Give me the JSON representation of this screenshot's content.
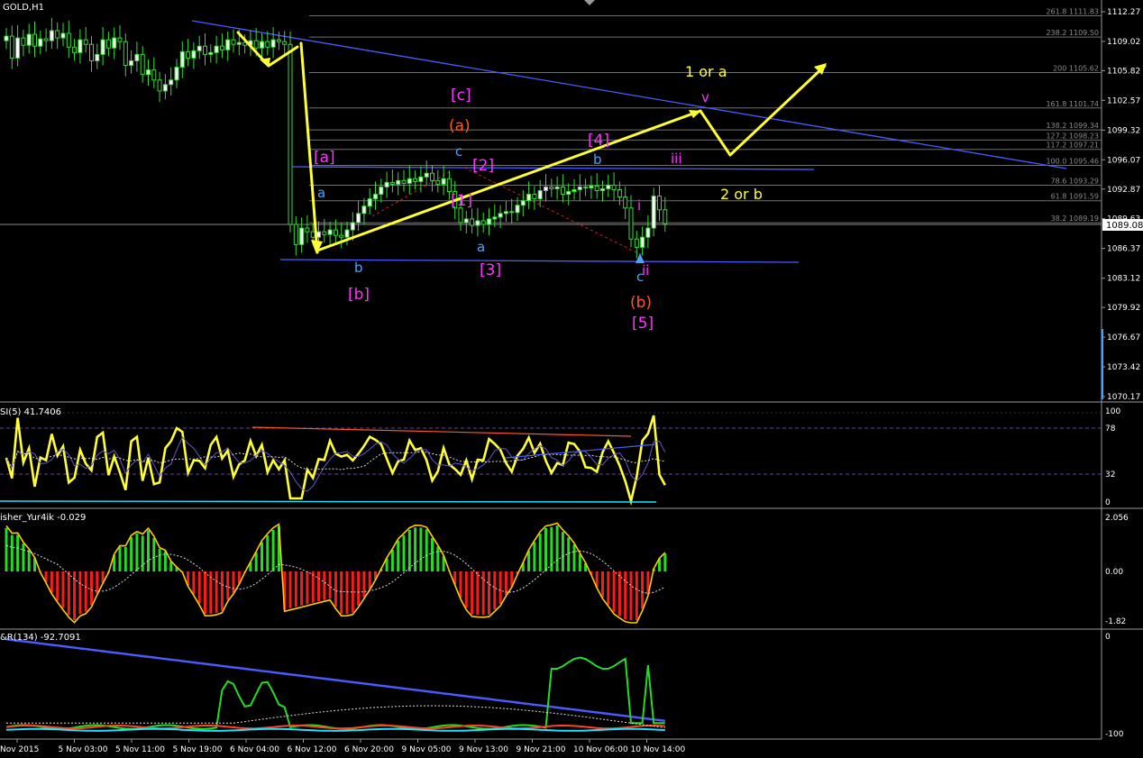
{
  "window": {
    "title": "GOLD,H1"
  },
  "colors": {
    "background": "#000000",
    "price_line": "#ffffff",
    "fib_line": "#6f6f6f",
    "wave_path": "#ffff33",
    "trend_line": "#4a5cff",
    "label_blue": "#4aa3ff",
    "label_magenta": "#ff33ff",
    "label_orange": "#ff5a1f",
    "label_yellow": "#ffff33",
    "rsi": "#ffff33",
    "fisher_up": "#22dd22",
    "fisher_down": "#ff1a1a",
    "wpr_fast": "#22dd22",
    "wpr_mid": "#ff4422",
    "wpr_slow": "#22e0ff",
    "wpr_trend": "#4a5cff"
  },
  "price_axis": {
    "ticks": [
      "1112.27",
      "1109.02",
      "1105.82",
      "1102.57",
      "1099.32",
      "1096.07",
      "1092.87",
      "1089.63",
      "1086.37",
      "1083.12",
      "1079.92",
      "1076.67",
      "1073.42",
      "1070.17"
    ],
    "current_price": "1089.08"
  },
  "fib_levels": [
    {
      "label": "261.8",
      "price": 1111.83,
      "text": "261.8 1111.83"
    },
    {
      "label": "238.2",
      "price": 1109.5,
      "text": "238.2 1109.50"
    },
    {
      "label": "200",
      "price": 1105.62,
      "text": "200 1105.62"
    },
    {
      "label": "161.8",
      "price": 1101.74,
      "text": "161.8 1101.74"
    },
    {
      "label": "138.2",
      "price": 1099.34,
      "text": "138.2 1099.34"
    },
    {
      "label": "127.2",
      "price": 1098.23,
      "text": "127.2 1098.23"
    },
    {
      "label": "117.2",
      "price": 1097.21,
      "text": "117.2 1097.21"
    },
    {
      "label": "100.0",
      "price": 1095.46,
      "text": "100.0 1095.46"
    },
    {
      "label": "78.6",
      "price": 1093.29,
      "text": "78.6 1093.29"
    },
    {
      "label": "61.8",
      "price": 1091.59,
      "text": "61.8 1091.59"
    },
    {
      "label": "38.2",
      "price": 1089.19,
      "text": "38.2 1089.19"
    }
  ],
  "wave_labels": {
    "bracket_a": "[a]",
    "a_blue_1": "a",
    "b_blue_1": "b",
    "bracket_b": "[b]",
    "bracket_c": "[c]",
    "paren_a": "(a)",
    "c_blue": "c",
    "bracket_2": "[2]",
    "bracket_1": "[1]",
    "a_blue_2": "a",
    "bracket_3": "[3]",
    "bracket_4": "[4]",
    "b_blue_2": "b",
    "wave_iii": "iii",
    "wave_i": "i",
    "c_blue_2": "c",
    "wave_ii": "ii",
    "paren_b": "(b)",
    "bracket_5": "[5]",
    "wave_v": "v",
    "one_or_a": "1 or a",
    "two_or_b": "2 or b"
  },
  "indicators": {
    "rsi": {
      "title": "SI(5) 41.7406",
      "ticks": [
        "100",
        "78",
        "32",
        "0"
      ]
    },
    "fisher": {
      "title": "isher_Yur4ik -0.029",
      "ticks": [
        "2.056",
        "0.00",
        "-1.82"
      ]
    },
    "wpr": {
      "title": "&R(134) -92.7091",
      "ticks": [
        "0",
        "-100"
      ]
    }
  },
  "time_axis": {
    "labels": [
      "Nov 2015",
      "5 Nov 03:00",
      "5 Nov 11:00",
      "5 Nov 19:00",
      "6 Nov 04:00",
      "6 Nov 12:00",
      "6 Nov 20:00",
      "9 Nov 05:00",
      "9 Nov 13:00",
      "9 Nov 21:00",
      "10 Nov 06:00",
      "10 Nov 14:00"
    ]
  },
  "chart_data": {
    "type": "line",
    "title": "GOLD,H1",
    "ylim": [
      1070.17,
      1112.27
    ],
    "series": [
      {
        "name": "GOLD,H1",
        "values": [
          1109.6,
          1107.2,
          1109.4,
          1108.6,
          1109.8,
          1108.5,
          1109.3,
          1109.1,
          1110.2,
          1109.4,
          1109.9,
          1108.4,
          1107.8,
          1109.2,
          1108.7,
          1106.9,
          1107.6,
          1109.2,
          1108.3,
          1109.4,
          1109.0,
          1106.4,
          1106.9,
          1107.6,
          1105.4,
          1105.9,
          1104.8,
          1103.6,
          1104.3,
          1104.8,
          1106.2,
          1107.9,
          1107.2,
          1108.0,
          1108.5,
          1107.6,
          1107.8,
          1108.5,
          1108.1,
          1109.2,
          1108.7,
          1108.9,
          1108.6,
          1109.1,
          1108.3,
          1109.0,
          1108.4,
          1109.2,
          1109.0,
          1108.7,
          1089.0,
          1086.8,
          1088.6,
          1088.2,
          1087.6,
          1088.2,
          1087.9,
          1088.4,
          1087.8,
          1087.6,
          1088.4,
          1089.2,
          1090.2,
          1091.0,
          1091.8,
          1092.3,
          1093.1,
          1093.6,
          1093.4,
          1093.8,
          1093.5,
          1094.0,
          1093.7,
          1094.2,
          1094.6,
          1093.8,
          1093.4,
          1094.0,
          1092.6,
          1090.8,
          1089.2,
          1089.6,
          1088.9,
          1089.4,
          1089.0,
          1089.6,
          1089.8,
          1090.2,
          1090.4,
          1090.3,
          1091.1,
          1091.6,
          1092.3,
          1091.8,
          1092.7,
          1093.1,
          1092.9,
          1093.1,
          1092.3,
          1092.6,
          1092.8,
          1093.1,
          1093.0,
          1093.2,
          1092.7,
          1092.9,
          1093.3,
          1092.8,
          1092.0,
          1090.8,
          1087.4,
          1086.5,
          1087.6,
          1088.6,
          1092.1,
          1090.6,
          1089.1
        ]
      }
    ]
  }
}
